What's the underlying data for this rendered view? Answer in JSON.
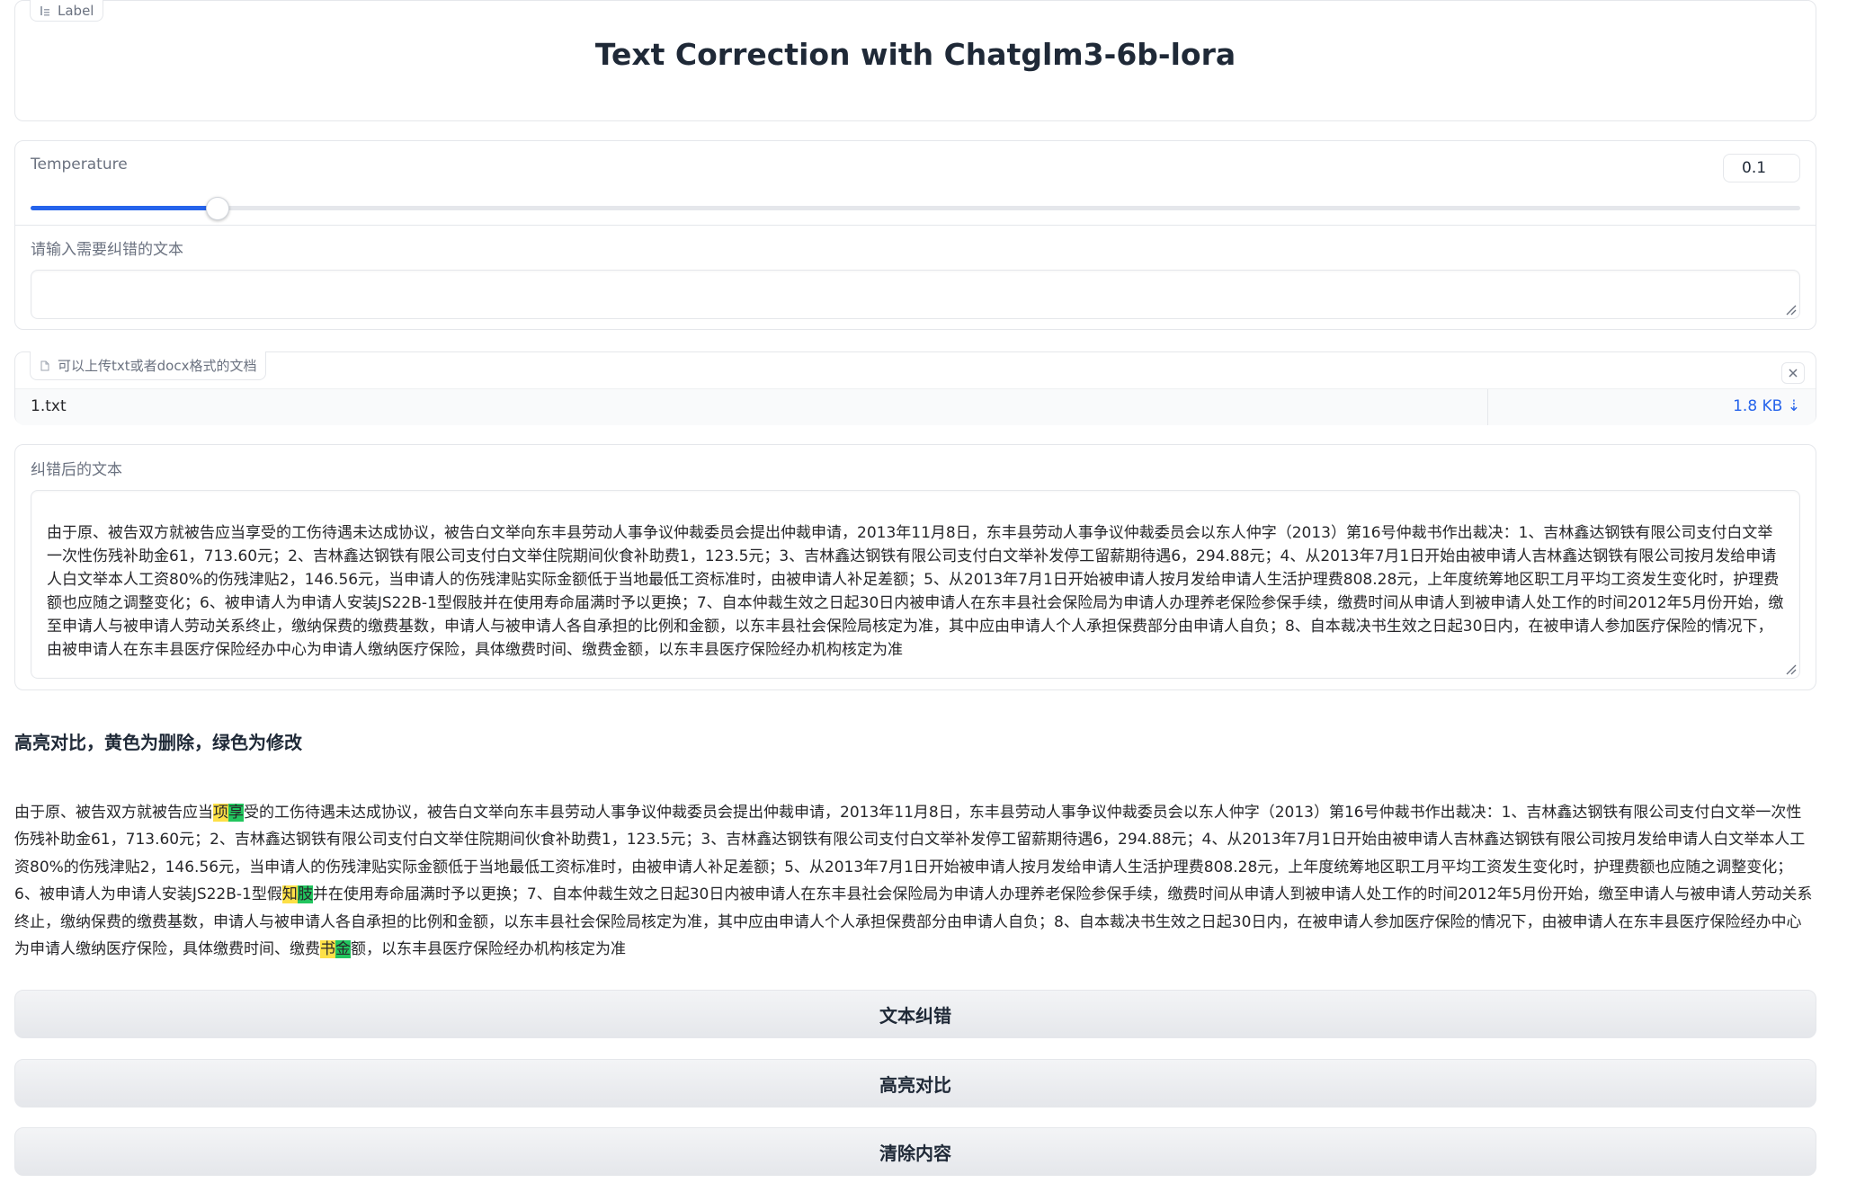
{
  "title_block": {
    "chip_label": "Label",
    "title": "Text Correction with Chatglm3-6b-lora"
  },
  "settings": {
    "temperature_label": "Temperature",
    "temperature_value": "0.1",
    "temperature_fraction": 0.105,
    "input_label": "请输入需要纠错的文本",
    "input_value": ""
  },
  "upload": {
    "chip_label": "可以上传txt或者docx格式的文档",
    "file_name": "1.txt",
    "file_size": "1.8 KB ⇣"
  },
  "output": {
    "label": "纠错后的文本",
    "text": "由于原、被告双方就被告应当享受的工伤待遇未达成协议，被告白文举向东丰县劳动人事争议仲裁委员会提出仲裁申请，2013年11月8日，东丰县劳动人事争议仲裁委员会以东人仲字（2013）第16号仲裁书作出裁决：1、吉林鑫达钢铁有限公司支付白文举一次性伤残补助金61，713.60元；2、吉林鑫达钢铁有限公司支付白文举住院期间伙食补助费1，123.5元；3、吉林鑫达钢铁有限公司支付白文举补发停工留薪期待遇6，294.88元；4、从2013年7月1日开始由被申请人吉林鑫达钢铁有限公司按月发给申请人白文举本人工资80%的伤残津贴2，146.56元，当申请人的伤残津贴实际金额低于当地最低工资标准时，由被申请人补足差额；5、从2013年7月1日开始被申请人按月发给申请人生活护理费808.28元，上年度统筹地区职工月平均工资发生变化时，护理费额也应随之调整变化；6、被申请人为申请人安装JS22B-1型假肢并在使用寿命届满时予以更换；7、自本仲裁生效之日起30日内被申请人在东丰县社会保险局为申请人办理养老保险参保手续，缴费时间从申请人到被申请人处工作的时间2012年5月份开始，缴至申请人与被申请人劳动关系终止，缴纳保费的缴费基数，申请人与被申请人各自承担的比例和金额，以东丰县社会保险局核定为准，其中应由申请人个人承担保费部分由申请人自负；8、自本裁决书生效之日起30日内，在被申请人参加医疗保险的情况下，由被申请人在东丰县医疗保险经办中心为申请人缴纳医疗保险，具体缴费时间、缴费金额，以东丰县医疗保险经办机构核定为准"
  },
  "compare": {
    "heading": "高亮对比，黄色为删除，绿色为修改",
    "seg1": "由于原、被告双方就被告应当",
    "del1": "项",
    "mod1": "享",
    "seg2": "受的工伤待遇未达成协议，被告白文举向东丰县劳动人事争议仲裁委员会提出仲裁申请，2013年11月8日，东丰县劳动人事争议仲裁委员会以东人仲字（2013）第16号仲裁书作出裁决：1、吉林鑫达钢铁有限公司支付白文举一次性伤残补助金61，713.60元；2、吉林鑫达钢铁有限公司支付白文举住院期间伙食补助费1，123.5元；3、吉林鑫达钢铁有限公司支付白文举补发停工留薪期待遇6，294.88元；4、从2013年7月1日开始由被申请人吉林鑫达钢铁有限公司按月发给申请人白文举本人工资80%的伤残津贴2，146.56元，当申请人的伤残津贴实际金额低于当地最低工资标准时，由被申请人补足差额；5、从2013年7月1日开始被申请人按月发给申请人生活护理费808.28元，上年度统筹地区职工月平均工资发生变化时，护理费额也应随之调整变化；6、被申请人为申请人安装JS22B-1型假",
    "del2": "知",
    "mod2": "肢",
    "seg3": "并在使用寿命届满时予以更换；7、自本仲裁生效之日起30日内被申请人在东丰县社会保险局为申请人办理养老保险参保手续，缴费时间从申请人到被申请人处工作的时间2012年5月份开始，缴至申请人与被申请人劳动关系终止，缴纳保费的缴费基数，申请人与被申请人各自承担的比例和金额，以东丰县社会保险局核定为准，其中应由申请人个人承担保费部分由申请人自负；8、自本裁决书生效之日起30日内，在被申请人参加医疗保险的情况下，由被申请人在东丰县医疗保险经办中心为申请人缴纳医疗保险，具体缴费时间、缴费",
    "del3": "书",
    "mod3": "金",
    "seg4": "额，以东丰县医疗保险经办机构核定为准"
  },
  "buttons": {
    "correct": "文本纠错",
    "highlight": "高亮对比",
    "clear": "清除内容"
  },
  "colors": {
    "accent": "#2563eb",
    "delete_highlight": "#fde047",
    "modify_highlight": "#22c55e"
  },
  "icons": {
    "label_chip": "label-icon",
    "upload_chip": "file-icon",
    "remove_file": "close-icon",
    "resize": "resize-handle-icon"
  }
}
